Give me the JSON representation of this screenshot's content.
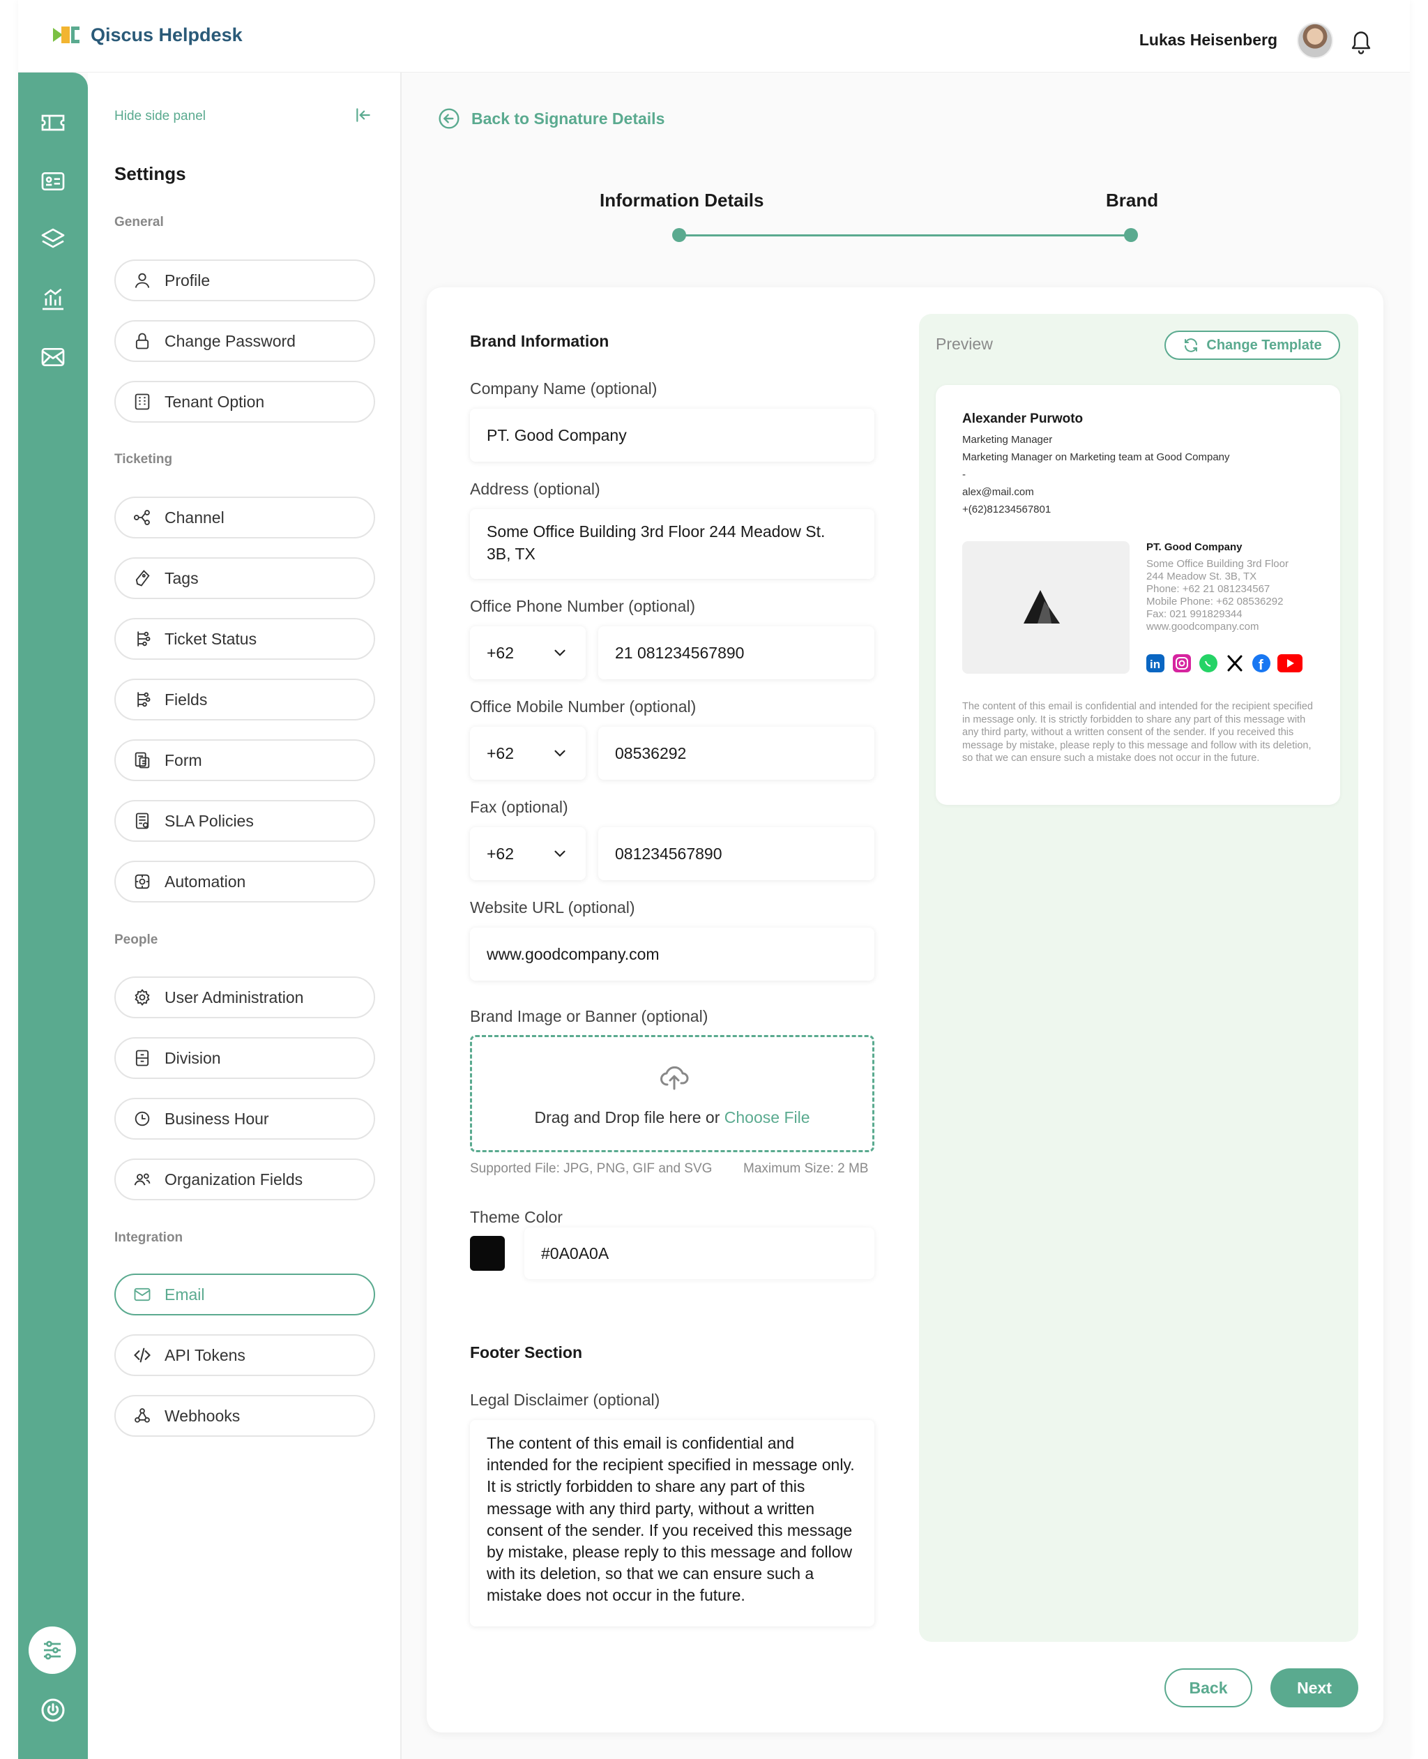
{
  "app": {
    "brand": "Qiscus Helpdesk",
    "user_name": "Lukas Heisenberg"
  },
  "colors": {
    "accent": "#5aaa8f",
    "preview_bg": "#eef7ee",
    "theme": "#0A0A0A"
  },
  "rail": {
    "icons": [
      "ticket-icon",
      "contact-card-icon",
      "layers-icon",
      "analytics-icon",
      "email-icon",
      "settings-sliders-icon",
      "power-icon"
    ]
  },
  "sidepanel": {
    "hide_label": "Hide side panel",
    "title": "Settings",
    "sections": {
      "general": "General",
      "ticketing": "Ticketing",
      "people": "People",
      "integration": "Integration"
    },
    "items": {
      "profile": "Profile",
      "change_password": "Change Password",
      "tenant_option": "Tenant Option",
      "channel": "Channel",
      "tags": "Tags",
      "ticket_status": "Ticket Status",
      "fields": "Fields",
      "form": "Form",
      "sla_policies": "SLA Policies",
      "automation": "Automation",
      "user_administration": "User Administration",
      "division": "Division",
      "business_hour": "Business Hour",
      "organization_fields": "Organization Fields",
      "email": "Email",
      "api_tokens": "API Tokens",
      "webhooks": "Webhooks"
    }
  },
  "main": {
    "back_link": "Back to Signature Details",
    "steps": [
      "Information Details",
      "Brand"
    ],
    "brand_info_title": "Brand Information",
    "company_name": {
      "label": "Company Name  (optional)",
      "value": "PT. Good Company"
    },
    "address": {
      "label": "Address  (optional)",
      "value": "Some Office Building 3rd Floor 244 Meadow St.\n3B, TX"
    },
    "office_phone": {
      "label": "Office Phone Number  (optional)",
      "prefix": "+62",
      "value": "21 081234567890"
    },
    "office_mobile": {
      "label": "Office Mobile Number  (optional)",
      "prefix": "+62",
      "value": "08536292"
    },
    "fax": {
      "label": "Fax  (optional)",
      "prefix": "+62",
      "value": "081234567890"
    },
    "website": {
      "label": "Website URL  (optional)",
      "value": "www.goodcompany.com"
    },
    "brand_image": {
      "label": "Brand Image or Banner (optional)",
      "drop_text": "Drag and Drop file here or ",
      "choose_file": "Choose File",
      "supported": "Supported File:  JPG, PNG, GIF and SVG",
      "max_size": "Maximum Size:  2 MB"
    },
    "theme_color": {
      "label": "Theme Color",
      "value": "#0A0A0A"
    },
    "footer_title": "Footer Section",
    "legal": {
      "label": "Legal Disclaimer  (optional)",
      "value": "The content of this email is confidential and intended for the recipient specified in message only. It is strictly forbidden to share any part of this message with any third party, without a written consent of the sender. If you received this message by mistake, please reply to this message and follow with its deletion, so that we can ensure such a mistake does not occur in the future."
    },
    "buttons": {
      "back": "Back",
      "next": "Next"
    }
  },
  "preview": {
    "label": "Preview",
    "change_template": "Change Template",
    "signature": {
      "name": "Alexander Purwoto",
      "title": "Marketing Manager",
      "subtitle": "Marketing Manager on Marketing team at Good Company",
      "dash": "-",
      "email": "alex@mail.com",
      "phone": "+(62)81234567801",
      "company": "PT. Good Company",
      "company_details": "Some Office Building 3rd Floor\n244 Meadow St. 3B, TX\nPhone: +62 21 081234567\nMobile Phone: +62 08536292\nFax: 021 991829344\nwww.goodcompany.com",
      "social_icons": [
        "linkedin-icon",
        "instagram-icon",
        "whatsapp-icon",
        "x-icon",
        "facebook-icon",
        "youtube-icon"
      ],
      "disclaimer": "The content of this email is confidential and intended for the recipient specified in message only. It is strictly forbidden to share any part of this message with any third party, without a written consent of the sender. If you received this message by mistake, please reply to this message and follow with its deletion, so that we can ensure such a mistake does not occur in the future."
    }
  }
}
